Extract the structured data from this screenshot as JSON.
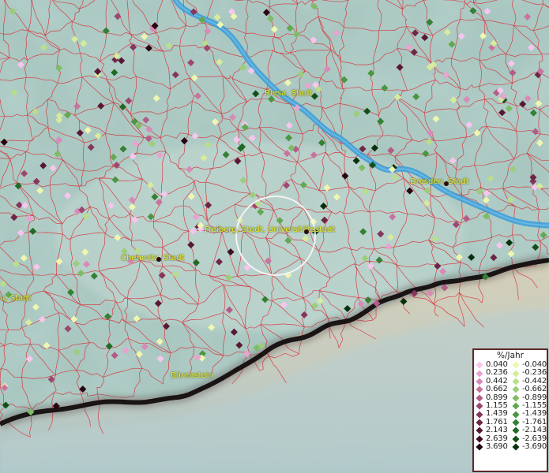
{
  "map": {
    "cities": [
      {
        "name": "Riesa, Stadt"
      },
      {
        "name": "Dresden, Stadt"
      },
      {
        "name": "Freiberg, Stadt, Universitätsstadt"
      },
      {
        "name": "Chemnitz, Stadt"
      },
      {
        "name": "u, Stadt"
      },
      {
        "name": "Bärenstein"
      }
    ],
    "colors": {
      "river": "#3a9cd8",
      "border": "#d8303a",
      "state_border": "#1a1414",
      "terrain_base": "#a9c7c0",
      "label": "#f2f230"
    }
  },
  "legend": {
    "title": "%/Jahr",
    "rows": [
      {
        "pos": "0.040",
        "neg": "-0.040",
        "pos_color": "#f6c6ee",
        "neg_color": "#eef7b0"
      },
      {
        "pos": "0.236",
        "neg": "-0.236",
        "pos_color": "#e6a4cf",
        "neg_color": "#d6ec9c"
      },
      {
        "pos": "0.442",
        "neg": "-0.442",
        "pos_color": "#d88ab8",
        "neg_color": "#b9de8c"
      },
      {
        "pos": "0.662",
        "neg": "-0.662",
        "pos_color": "#c8749f",
        "neg_color": "#9ccd7a"
      },
      {
        "pos": "0.899",
        "neg": "-0.899",
        "pos_color": "#b25c86",
        "neg_color": "#7fbc66"
      },
      {
        "pos": "1.155",
        "neg": "-1.155",
        "pos_color": "#9c4870",
        "neg_color": "#62a952"
      },
      {
        "pos": "1.439",
        "neg": "-1.439",
        "pos_color": "#86365c",
        "neg_color": "#4a9642"
      },
      {
        "pos": "1.761",
        "neg": "-1.761",
        "pos_color": "#6e2646",
        "neg_color": "#348034"
      },
      {
        "pos": "2.143",
        "neg": "-2.143",
        "pos_color": "#581834",
        "neg_color": "#206a26"
      },
      {
        "pos": "2.639",
        "neg": "-2.639",
        "pos_color": "#400c22",
        "neg_color": "#12501a"
      },
      {
        "pos": "3.690",
        "neg": "-3.690",
        "pos_color": "#260412",
        "neg_color": "#06300c"
      }
    ]
  }
}
